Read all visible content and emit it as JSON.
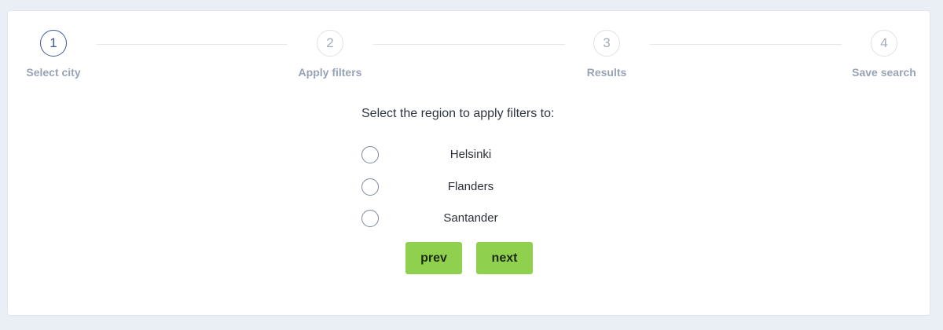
{
  "stepper": {
    "steps": [
      {
        "number": "1",
        "label": "Select city",
        "active": true
      },
      {
        "number": "2",
        "label": "Apply filters",
        "active": false
      },
      {
        "number": "3",
        "label": "Results",
        "active": false
      },
      {
        "number": "4",
        "label": "Save search",
        "active": false
      }
    ]
  },
  "form": {
    "prompt": "Select the region to apply filters to:",
    "options": [
      {
        "label": "Helsinki",
        "selected": false
      },
      {
        "label": "Flanders",
        "selected": false
      },
      {
        "label": "Santander",
        "selected": false
      }
    ]
  },
  "buttons": {
    "prev_label": "prev",
    "next_label": "next"
  },
  "colors": {
    "background": "#eaeef5",
    "active_step": "#3d5a96",
    "button_green": "#8fd14f",
    "step_label": "#97a3b6"
  }
}
